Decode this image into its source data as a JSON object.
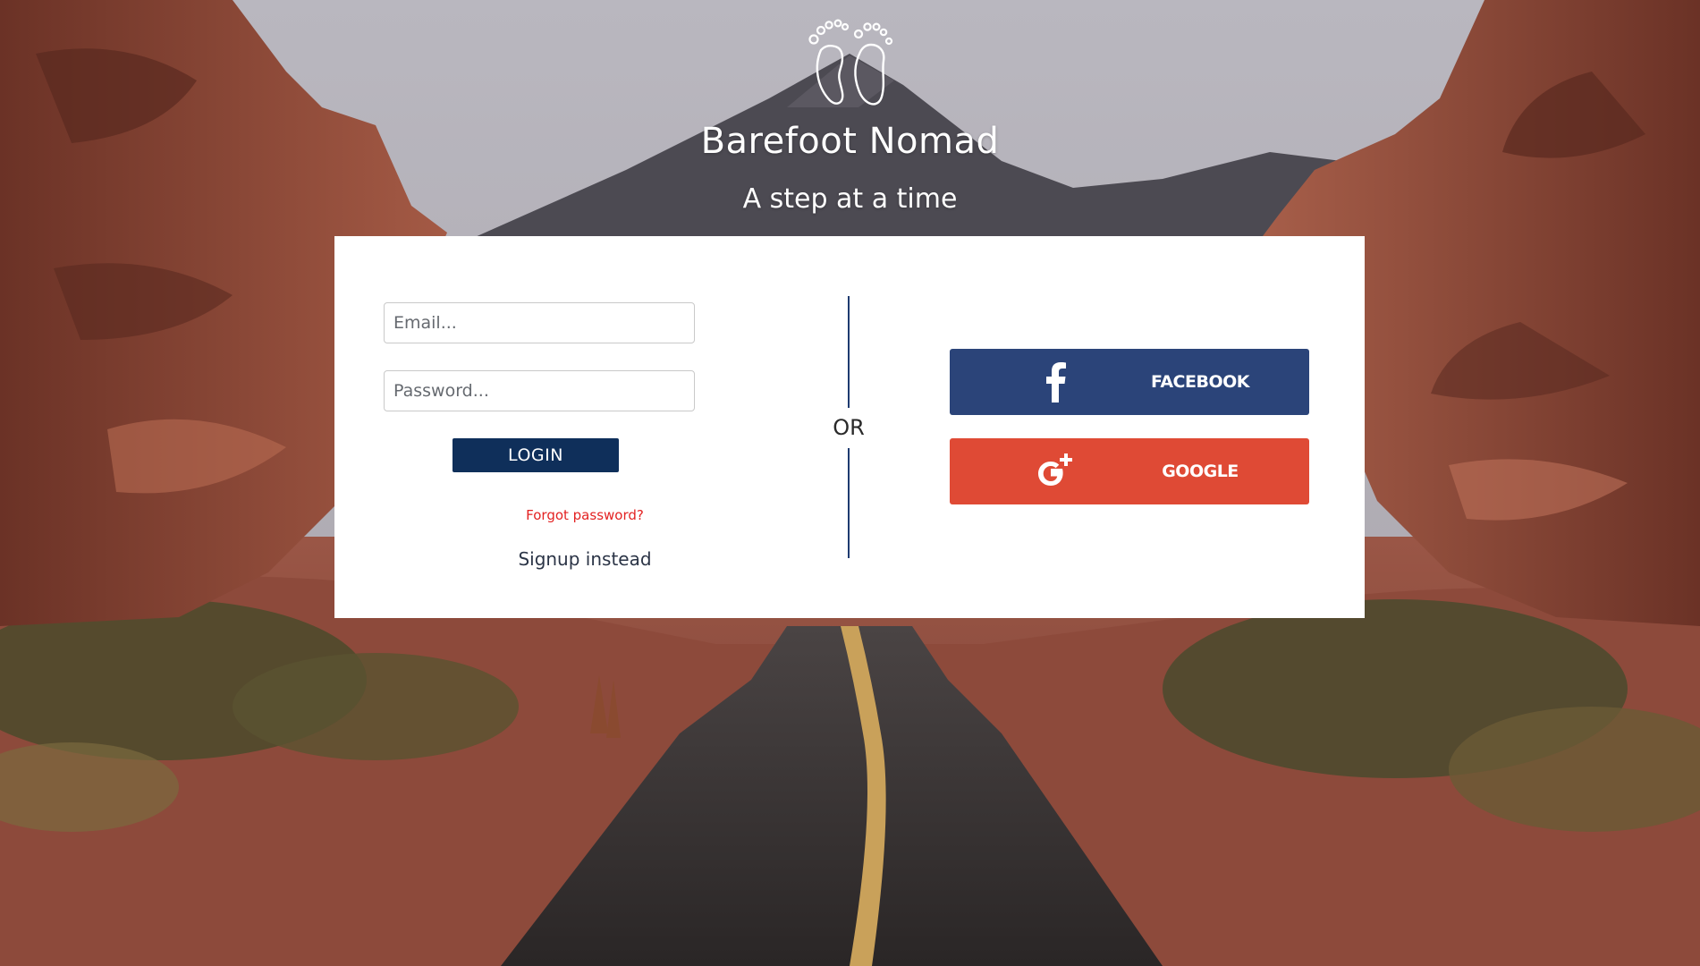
{
  "brand": {
    "title": "Barefoot Nomad",
    "tagline": "A step at a time",
    "logo_icon": "footprints-icon"
  },
  "login_form": {
    "email_placeholder": "Email...",
    "password_placeholder": "Password...",
    "login_label": "LOGIN",
    "forgot_password_label": "Forgot password?",
    "signup_label": "Signup instead"
  },
  "separator": {
    "label": "OR"
  },
  "social_login": {
    "facebook": {
      "label": "FACEBOOK",
      "icon": "facebook-icon",
      "color": "#2b4479"
    },
    "google": {
      "label": "GOOGLE",
      "icon": "google-plus-icon",
      "color": "#df4a35"
    }
  },
  "colors": {
    "login_button": "#0f2f5a",
    "forgot_link": "#e32222",
    "divider": "#1f3b70"
  }
}
